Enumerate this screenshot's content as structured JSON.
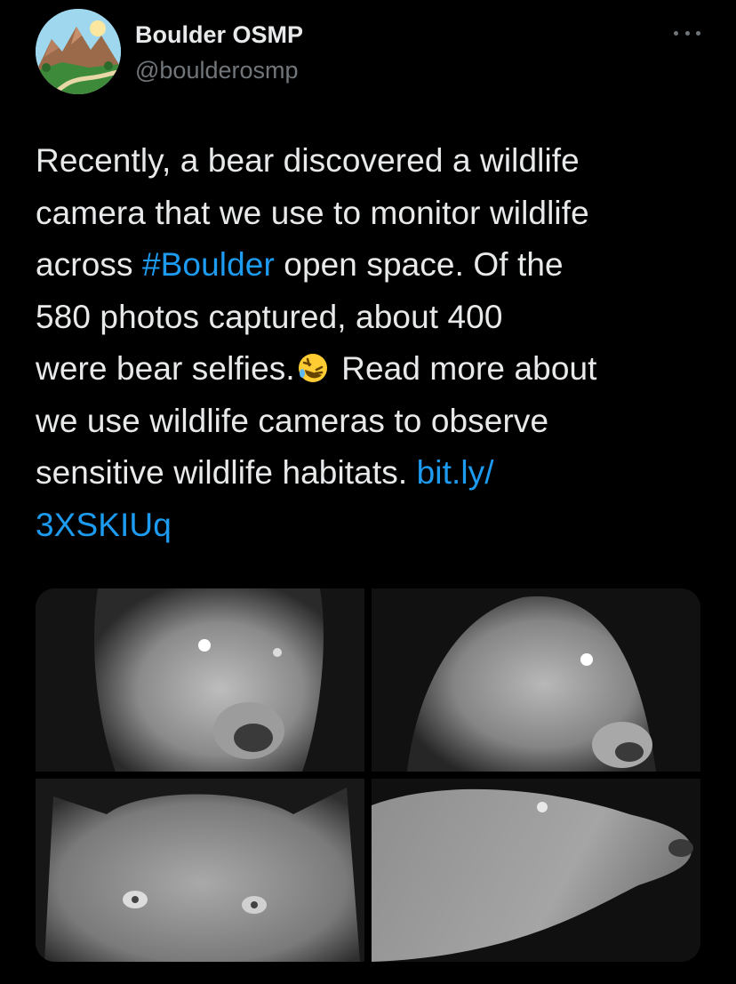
{
  "author": {
    "name": "Boulder OSMP",
    "handle": "@boulderosmp",
    "avatar_icon": "mountain-landscape-avatar"
  },
  "more_icon": "more-horizontal-icon",
  "tweet": {
    "line1": "Recently, a bear discovered a wildlife",
    "line2": "camera that we use to monitor wildlife",
    "line3_a": "across ",
    "hashtag": "#Boulder",
    "line3_b": " open space. Of the",
    "line4": "580 photos captured, about 400",
    "line5_a": "were bear selfies.",
    "emoji": "rolling-on-floor-laughing-emoji",
    "line5_b": " Read more about",
    "line6": "we use wildlife cameras to observe",
    "line7_a": "sensitive wildlife habitats. ",
    "link_part1": "bit.ly/",
    "link_part2": "3XSKIUq"
  },
  "media": {
    "photos": [
      "bear-photo-1",
      "bear-photo-2",
      "bear-photo-3",
      "bear-photo-4"
    ]
  },
  "colors": {
    "background": "#000000",
    "text": "#e7e9ea",
    "secondary": "#71767b",
    "link": "#1d9bf0"
  }
}
